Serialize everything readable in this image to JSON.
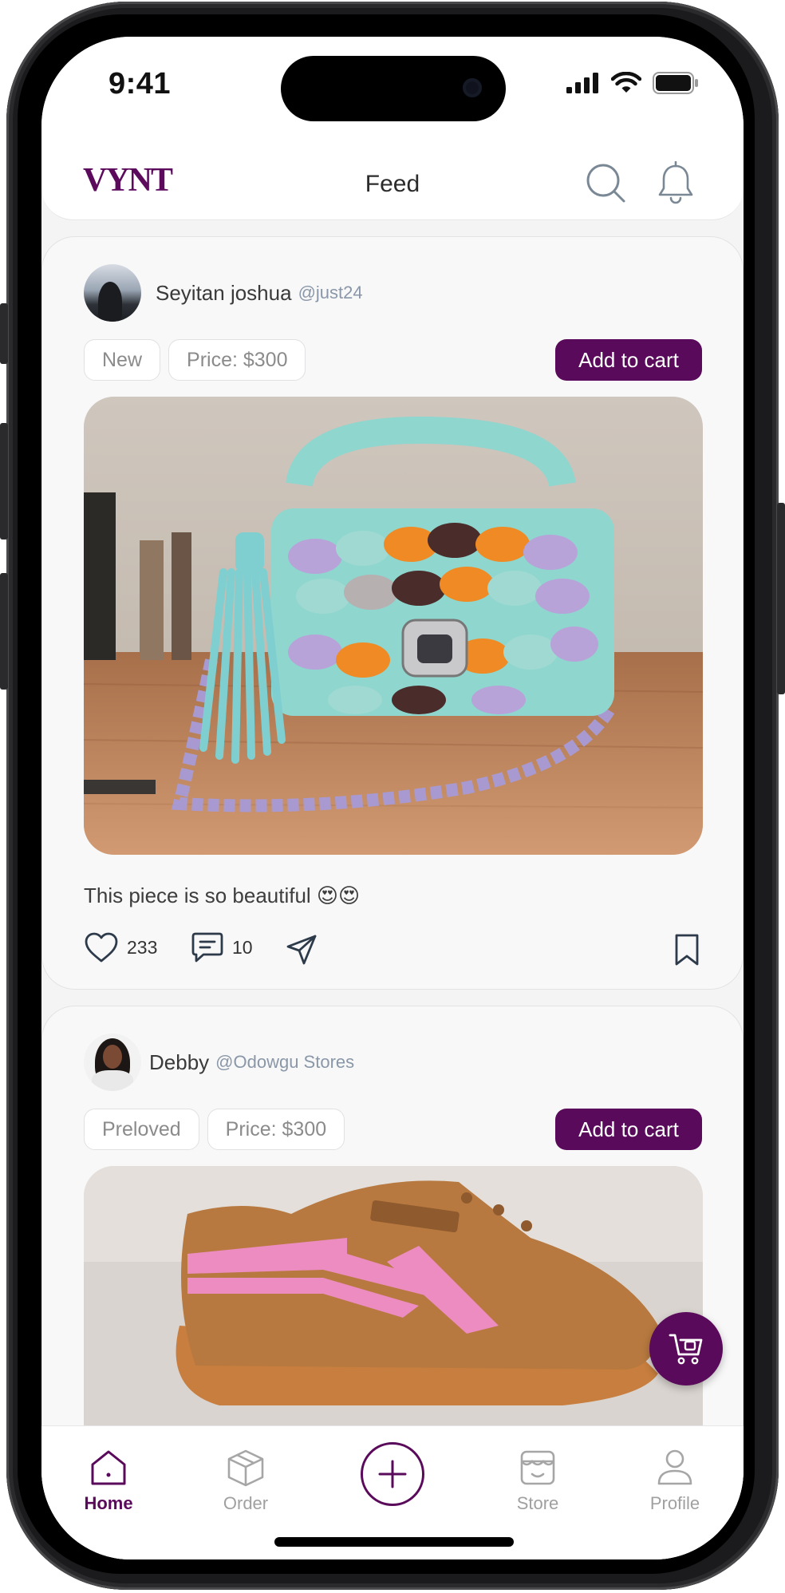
{
  "status_bar": {
    "time": "9:41"
  },
  "header": {
    "logo": "VYNT",
    "title": "Feed"
  },
  "posts": [
    {
      "user_name": "Seyitan joshua",
      "user_handle": "@just24",
      "condition": "New",
      "price": "Price: $300",
      "cart_label": "Add to cart",
      "caption": "This piece is so beautiful 😍😍",
      "likes": "233",
      "comments": "10"
    },
    {
      "user_name": "Debby",
      "user_handle": "@Odowgu Stores",
      "condition": "Preloved",
      "price": "Price: $300",
      "cart_label": "Add to cart"
    }
  ],
  "tabs": [
    {
      "label": "Home",
      "icon": "home-icon",
      "active": true
    },
    {
      "label": "Order",
      "icon": "box-icon",
      "active": false
    },
    {
      "label": "",
      "icon": "plus-icon",
      "active": false
    },
    {
      "label": "Store",
      "icon": "store-icon",
      "active": false
    },
    {
      "label": "Profile",
      "icon": "person-icon",
      "active": false
    }
  ],
  "colors": {
    "brand": "#5a0a5b",
    "background": "#f4f4f5",
    "handle": "#8a97a8"
  }
}
